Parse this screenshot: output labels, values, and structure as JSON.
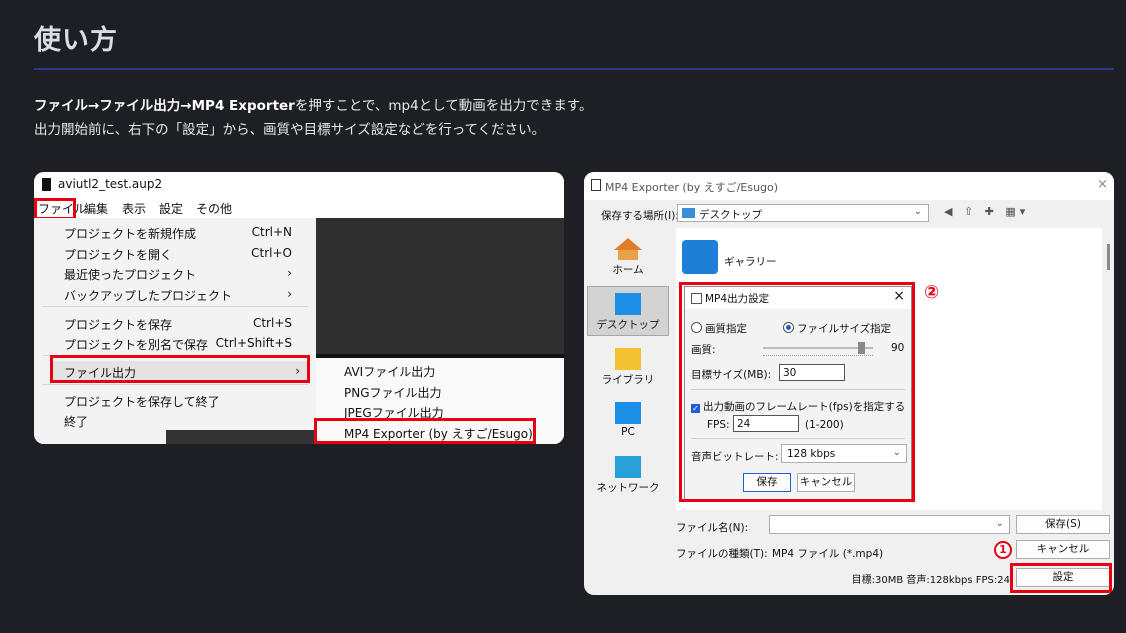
{
  "heading": "使い方",
  "intro": {
    "line1_bold": "ファイル→ファイル出力→MP4 Exporter",
    "line1_rest": "を押すことで、mp4として動画を出力できます。",
    "line2": "出力開始前に、右下の「設定」から、画質や目標サイズ設定などを行ってください。"
  },
  "left_shot": {
    "window_title": "aviutl2_test.aup2",
    "menubar": [
      "ファイル",
      "編集",
      "表示",
      "設定",
      "その他"
    ],
    "file_menu": [
      {
        "label": "プロジェクトを新規作成",
        "shortcut": "Ctrl+N"
      },
      {
        "label": "プロジェクトを開く",
        "shortcut": "Ctrl+O"
      },
      {
        "label": "最近使ったプロジェクト",
        "shortcut": "›"
      },
      {
        "label": "バックアップしたプロジェクト",
        "shortcut": "›"
      },
      {
        "label": "プロジェクトを保存",
        "shortcut": "Ctrl+S"
      },
      {
        "label": "プロジェクトを別名で保存",
        "shortcut": "Ctrl+Shift+S"
      },
      {
        "label": "ファイル出力",
        "shortcut": "›"
      },
      {
        "label": "プロジェクトを保存して終了",
        "shortcut": ""
      },
      {
        "label": "終了",
        "shortcut": ""
      }
    ],
    "export_submenu": [
      "AVIファイル出力",
      "PNGファイル出力",
      "JPEGファイル出力",
      "MP4 Exporter (by えすご/Esugo)"
    ]
  },
  "right_shot": {
    "window_title": "MP4 Exporter (by えすご/Esugo)",
    "close_glyph": "×",
    "save_location_label": "保存する場所(I):",
    "save_location_value": "デスクトップ",
    "toolbar_icons": [
      "back-icon",
      "up-folder-icon",
      "new-folder-icon",
      "view-menu-icon"
    ],
    "toolbar_glyphs": "◀ ⇧ ✚ ▦▾",
    "sidebar": [
      "ホーム",
      "デスクトップ",
      "ライブラリ",
      "PC",
      "ネットワーク"
    ],
    "gallery_label": "ギャラリー",
    "settings_dialog": {
      "title": "MP4出力設定",
      "close": "×",
      "mode_quality": "画質指定",
      "mode_size": "ファイルサイズ指定",
      "quality_label": "画質:",
      "quality_value": "90",
      "quality_fraction": 0.9,
      "target_size_label": "目標サイズ(MB):",
      "target_size_value": "30",
      "fps_checkbox": "出力動画のフレームレート(fps)を指定する",
      "fps_label": "FPS:",
      "fps_value": "24",
      "fps_range": "(1-200)",
      "audio_label": "音声ビットレート:",
      "audio_value": "128 kbps",
      "save_button": "保存",
      "cancel_button": "キャンセル",
      "marker": "②"
    },
    "filename_label": "ファイル名(N):",
    "filename_value": "",
    "filetype_label": "ファイルの種類(T):",
    "filetype_value": "MP4 ファイル (*.mp4)",
    "save_button": "保存(S)",
    "cancel_button": "キャンセル",
    "settings_button": "設定",
    "marker": "1",
    "status": "目標:30MB 音声:128kbps FPS:24"
  },
  "colors": {
    "background": "#1e1f24",
    "rule": "#2d3a8c",
    "highlight": "#e60012",
    "accent": "#1d5fd6"
  }
}
